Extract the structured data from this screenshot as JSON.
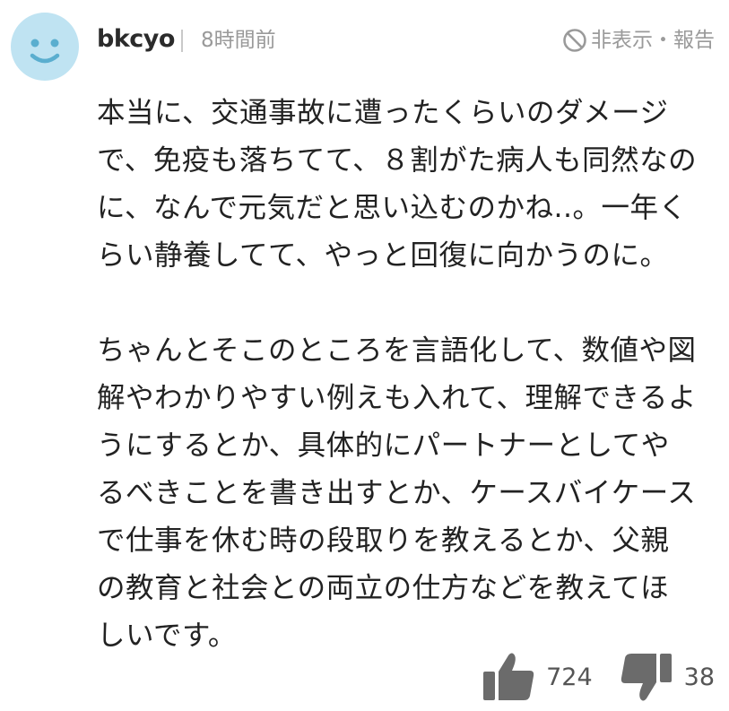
{
  "comment": {
    "username": "bkcyo",
    "time": "8時間前",
    "report_label": "非表示・報告",
    "paragraphs": [
      [
        "本当に、交通事故に遭ったくらいのダメージ",
        "で、免疫も落ちてて、８割がた病人も同然なの",
        "に、なんで元気だと思い込むのかね..。一年く",
        "らい静養してて、やっと回復に向かうのに。"
      ],
      [
        "ちゃんとそこのところを言語化して、数値や図",
        "解やわかりやすい例えも入れて、理解できるよ",
        "うにするとか、具体的にパートナーとしてや",
        "るべきことを書き出すとか、ケースバイケース",
        "で仕事を休む時の段取りを教えるとか、父親",
        "の教育と社会との両立の仕方などを教えてほ",
        "しいです。"
      ]
    ],
    "likes": "724",
    "dislikes": "38"
  },
  "icons": {
    "avatar": "smiley-face-icon",
    "report": "prohibited-icon",
    "like": "thumbs-up-icon",
    "dislike": "thumbs-down-icon"
  },
  "colors": {
    "avatar_bg": "#bfe3f2",
    "avatar_face": "#5aaecf",
    "muted_text": "#9a9a9a",
    "icon_gray": "#6b6b6b"
  }
}
